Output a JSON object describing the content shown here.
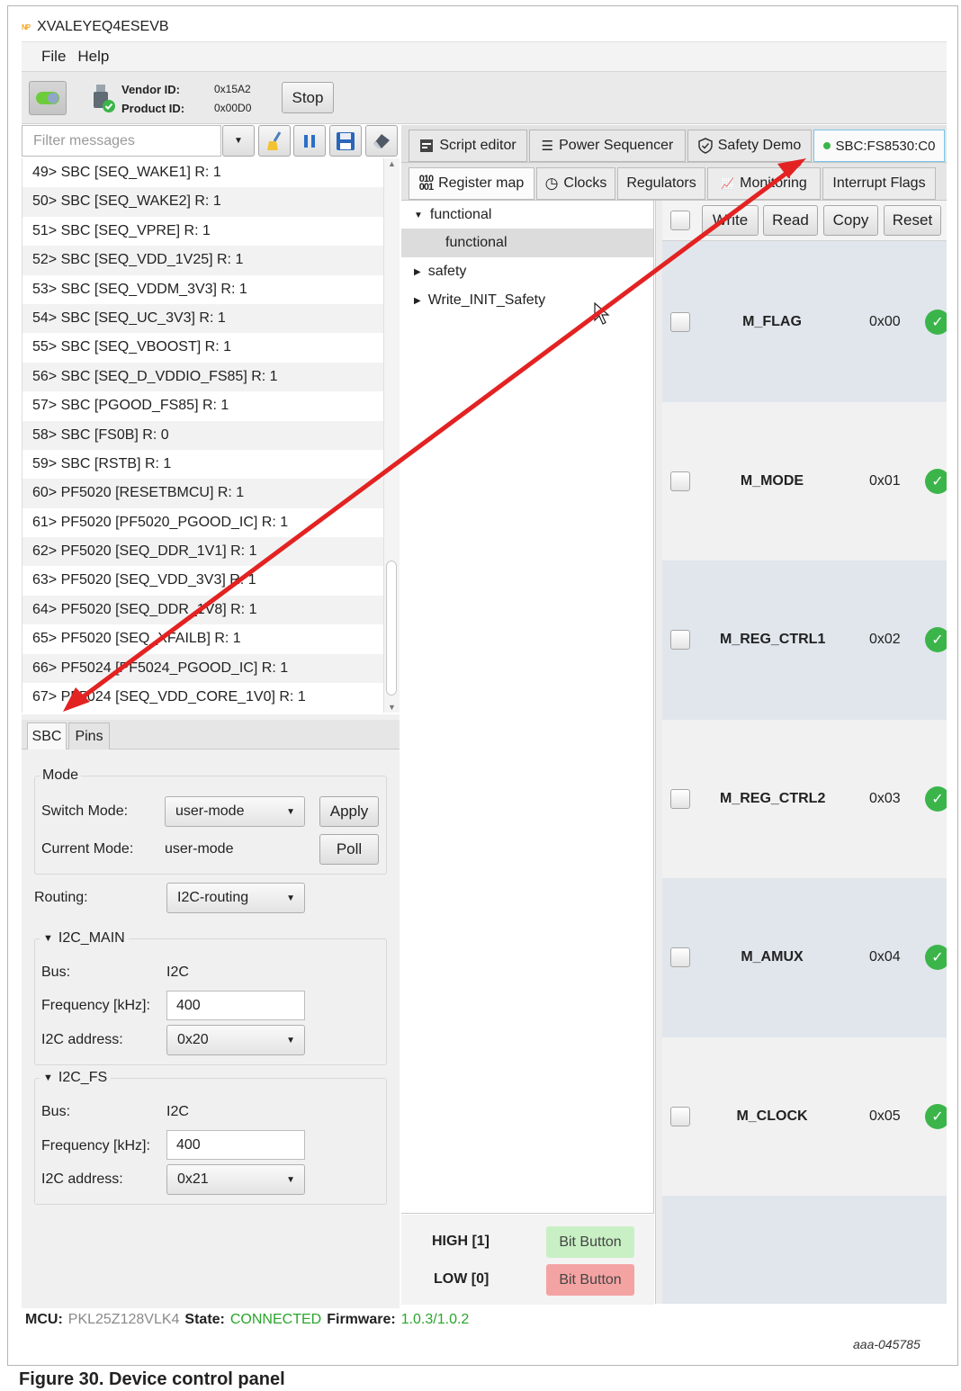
{
  "window": {
    "title": "XVALEYEQ4ESEVB",
    "logo_text": "NP"
  },
  "menu": {
    "file": "File",
    "help": "Help"
  },
  "toolbar": {
    "vendor_label": "Vendor ID:",
    "vendor_value": "0x15A2",
    "product_label": "Product ID:",
    "product_value": "0x00D0",
    "stop_label": "Stop"
  },
  "filter": {
    "placeholder": "Filter messages"
  },
  "messages": [
    "49> SBC [SEQ_WAKE1] R: 1",
    "50> SBC [SEQ_WAKE2] R: 1",
    "51> SBC [SEQ_VPRE] R: 1",
    "52> SBC [SEQ_VDD_1V25] R: 1",
    "53> SBC [SEQ_VDDM_3V3] R: 1",
    "54> SBC [SEQ_UC_3V3] R: 1",
    "55> SBC [SEQ_VBOOST] R: 1",
    "56> SBC [SEQ_D_VDDIO_FS85] R: 1",
    "57> SBC [PGOOD_FS85] R: 1",
    "58> SBC [FS0B] R: 0",
    "59> SBC [RSTB] R: 1",
    "60> PF5020 [RESETBMCU] R: 1",
    "61> PF5020 [PF5020_PGOOD_IC] R: 1",
    "62> PF5020 [SEQ_DDR_1V1] R: 1",
    "63> PF5020 [SEQ_VDD_3V3] R: 1",
    "64> PF5020 [SEQ_DDR_1V8] R: 1",
    "65> PF5020 [SEQ_XFAILB] R: 1",
    "66> PF5024 [PF5024_PGOOD_IC] R: 1",
    "67> PF5024 [SEQ_VDD_CORE_1V0] R: 1"
  ],
  "lower_tabs": {
    "sbc": "SBC",
    "pins": "Pins"
  },
  "mode": {
    "group_title": "Mode",
    "switch_label": "Switch Mode:",
    "switch_value": "user-mode",
    "apply_label": "Apply",
    "current_label": "Current Mode:",
    "current_value": "user-mode",
    "poll_label": "Poll"
  },
  "routing": {
    "label": "Routing:",
    "value": "I2C-routing"
  },
  "i2c_main": {
    "title": "I2C_MAIN",
    "bus_label": "Bus:",
    "bus_value": "I2C",
    "freq_label": "Frequency [kHz]:",
    "freq_value": "400",
    "addr_label": "I2C address:",
    "addr_value": "0x20"
  },
  "i2c_fs": {
    "title": "I2C_FS",
    "bus_label": "Bus:",
    "bus_value": "I2C",
    "freq_label": "Frequency [kHz]:",
    "freq_value": "400",
    "addr_label": "I2C address:",
    "addr_value": "0x21"
  },
  "main_tabs": {
    "script_editor": "Script editor",
    "power_sequencer": "Power Sequencer",
    "safety_demo": "Safety Demo",
    "sbc": "SBC:FS8530:C0"
  },
  "reg_tabs": {
    "register_map": "Register map",
    "clocks": "Clocks",
    "regulators": "Regulators",
    "monitoring": "Monitoring",
    "interrupt_flags": "Interrupt Flags"
  },
  "tree": {
    "functional": "functional",
    "functional_child": "functional",
    "safety": "safety",
    "write_init": "Write_INIT_Safety"
  },
  "reg_actions": {
    "write": "Write",
    "read": "Read",
    "copy": "Copy",
    "reset": "Reset"
  },
  "registers": [
    {
      "name": "M_FLAG",
      "addr": "0x00"
    },
    {
      "name": "M_MODE",
      "addr": "0x01"
    },
    {
      "name": "M_REG_CTRL1",
      "addr": "0x02"
    },
    {
      "name": "M_REG_CTRL2",
      "addr": "0x03"
    },
    {
      "name": "M_AMUX",
      "addr": "0x04"
    },
    {
      "name": "M_CLOCK",
      "addr": "0x05"
    }
  ],
  "bits": {
    "high_label": "HIGH [1]",
    "low_label": "LOW [0]",
    "high_button": "Bit Button",
    "low_button": "Bit Button",
    "high_color": "#c8f0c4",
    "low_color": "#f4a3a3"
  },
  "status": {
    "mcu_label": "MCU:",
    "mcu_value": "PKL25Z128VLK4",
    "state_label": "State:",
    "state_value": "CONNECTED",
    "fw_label": "Firmware:",
    "fw_value": "1.0.3/1.0.2"
  },
  "figure": {
    "id": "aaa-045785",
    "caption": "Figure 30.  Device control panel"
  },
  "colors": {
    "connected": "#2aa52a",
    "arrow": "#e32222",
    "ok": "#3bb54a"
  }
}
